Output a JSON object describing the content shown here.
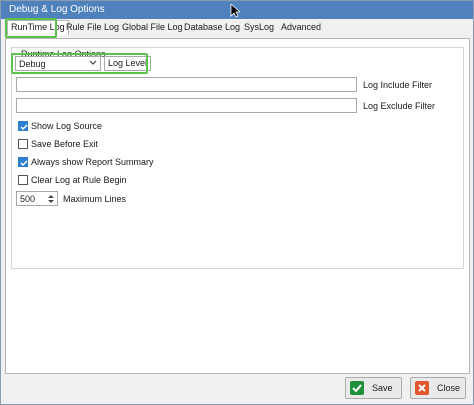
{
  "window": {
    "title": "Debug & Log Options"
  },
  "tabs": [
    {
      "label": "RunTime Log",
      "active": true
    },
    {
      "label": "Rule File Log"
    },
    {
      "label": "Global File Log"
    },
    {
      "label": "Database Log"
    },
    {
      "label": "SysLog"
    },
    {
      "label": "Advanced"
    }
  ],
  "runtime": {
    "group_title": "Runtime Log Options",
    "log_level_value": "Debug",
    "log_level_label": "Log Level",
    "include_filter_label": "Log Include Filter",
    "include_filter_value": "",
    "exclude_filter_label": "Log Exclude Filter",
    "exclude_filter_value": "",
    "options": [
      {
        "label": "Show Log Source",
        "checked": true
      },
      {
        "label": "Save Before Exit",
        "checked": false
      },
      {
        "label": "Always show Report Summary",
        "checked": true
      },
      {
        "label": "Clear Log at Rule Begin",
        "checked": false
      }
    ],
    "max_lines_value": "500",
    "max_lines_label": "Maximum Lines"
  },
  "buttons": {
    "save": "Save",
    "close": "Close"
  },
  "colors": {
    "titlebar": "#4f81bd",
    "highlight": "#5cc34a",
    "check": "#2f7fd1",
    "save_icon": "#1e8f3a",
    "close_icon": "#e0572b"
  }
}
